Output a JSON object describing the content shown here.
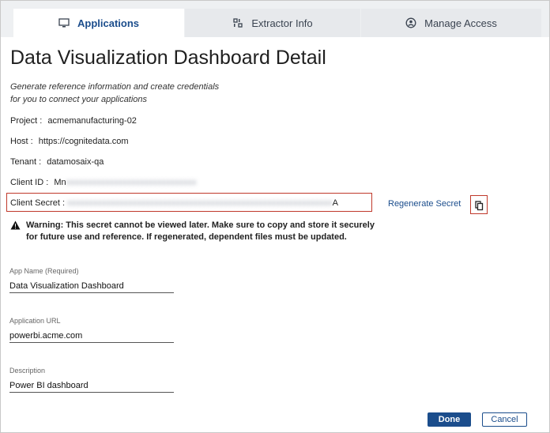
{
  "tabs": [
    {
      "label": "Applications",
      "icon": "monitor-icon",
      "active": true
    },
    {
      "label": "Extractor Info",
      "icon": "grid-icon",
      "active": false
    },
    {
      "label": "Manage Access",
      "icon": "user-circle-icon",
      "active": false
    }
  ],
  "page": {
    "title": "Data Visualization Dashboard Detail",
    "intro_line1": "Generate reference information and create credentials",
    "intro_line2": "for you to connect your applications"
  },
  "details": {
    "project_label": "Project :",
    "project_value": "acmemanufacturing-02",
    "host_label": "Host :",
    "host_value": "https://cognitedata.com",
    "tenant_label": "Tenant :",
    "tenant_value": "datamosaix-qa",
    "client_id_label": "Client ID :",
    "client_id_prefix": "Mn",
    "client_id_masked": "xxxxxxxxxxxxxxxxxxxxxxxxxxxxxx",
    "client_secret_label": "Client Secret :",
    "client_secret_masked": "xxxxxxxxxxxxxxxxxxxxxxxxxxxxxxxxxxxxxxxxxxxxxxxxxxxxxxxxxxxxx",
    "client_secret_suffix": "A"
  },
  "actions": {
    "regenerate_label": "Regenerate Secret",
    "done_label": "Done",
    "cancel_label": "Cancel"
  },
  "warning": {
    "text": "Warning: This secret cannot be viewed later. Make sure to copy and store it securely for future use and reference. If regenerated, dependent files must be updated."
  },
  "form": {
    "app_name_label": "App Name (Required)",
    "app_name_value": "Data Visualization Dashboard",
    "app_url_label": "Application URL",
    "app_url_value": "powerbi.acme.com",
    "description_label": "Description",
    "description_value": "Power BI dashboard"
  },
  "colors": {
    "accent": "#1b4d8c",
    "highlight_border": "#c0392b"
  }
}
